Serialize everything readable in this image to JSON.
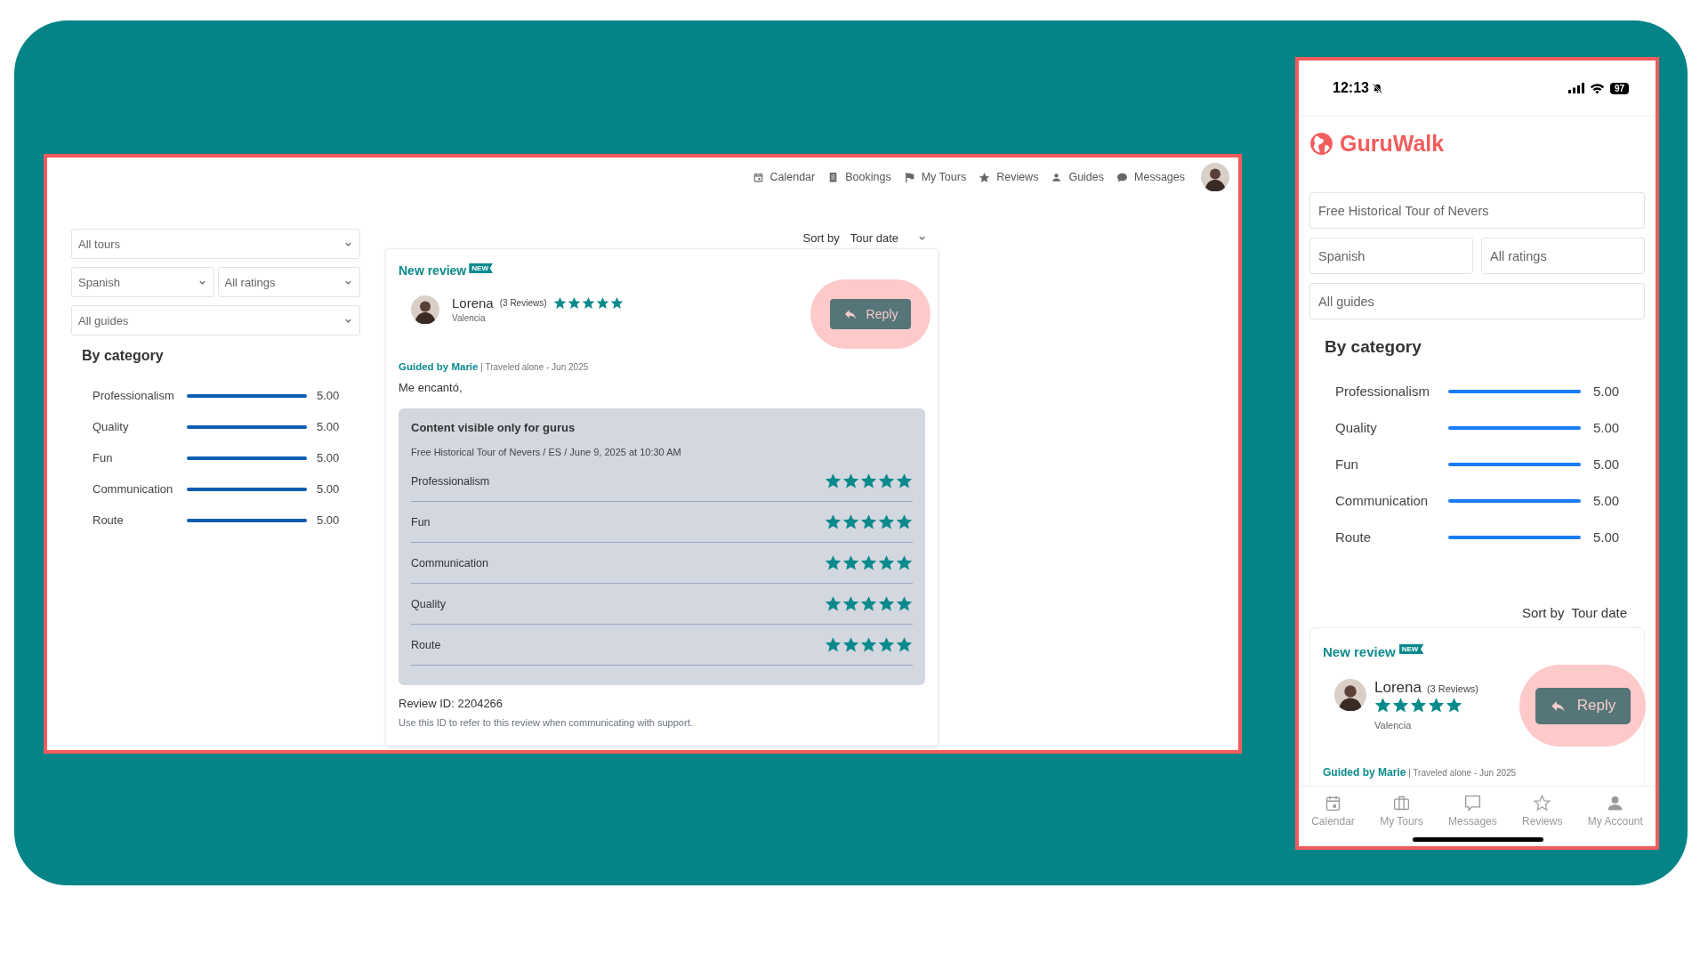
{
  "desktop": {
    "nav": [
      {
        "label": "Calendar"
      },
      {
        "label": "Bookings"
      },
      {
        "label": "My Tours"
      },
      {
        "label": "Reviews"
      },
      {
        "label": "Guides"
      },
      {
        "label": "Messages"
      }
    ],
    "filters": {
      "tour": "All tours",
      "language": "Spanish",
      "rating": "All ratings",
      "guide": "All guides"
    },
    "category_title": "By category",
    "categories": [
      {
        "name": "Professionalism",
        "level": 1,
        "value": "5.00"
      },
      {
        "name": "Quality",
        "level": 1,
        "value": "5.00"
      },
      {
        "name": "Fun",
        "level": 1,
        "value": "5.00"
      },
      {
        "name": "Communication",
        "level": 1,
        "value": "5.00"
      },
      {
        "name": "Route",
        "level": 1,
        "value": "5.00"
      }
    ],
    "sort": {
      "label": "Sort by",
      "value": "Tour date"
    },
    "review": {
      "title": "New review",
      "badge": "NEW",
      "author": "Lorena",
      "author_reviews": "(3 Reviews)",
      "stars": 5,
      "location": "Valencia",
      "reply": "Reply",
      "guided_by": "Guided by Marie",
      "trip": "| Traveled alone - Jun 2025",
      "text": "Me encantó,",
      "private": {
        "title": "Content visible only for gurus",
        "tour": "Free Historical Tour of Nevers / ES / June 9, 2025 at 10:30 AM",
        "ratings": [
          {
            "name": "Professionalism",
            "stars": 5
          },
          {
            "name": "Fun",
            "stars": 5
          },
          {
            "name": "Communication",
            "stars": 5
          },
          {
            "name": "Quality",
            "stars": 5
          },
          {
            "name": "Route",
            "stars": 5
          }
        ]
      },
      "review_id": "Review ID: 2204266",
      "note": "Use this ID to refer to this review when communicating with support."
    }
  },
  "mobile": {
    "status_bar": {
      "time": "12:13",
      "battery": "97"
    },
    "logo": "GuruWalk",
    "filters": {
      "tour": "Free Historical Tour of Nevers",
      "language": "Spanish",
      "rating": "All ratings",
      "guide": "All guides"
    },
    "category_title": "By category",
    "categories": [
      {
        "name": "Professionalism",
        "level": 1,
        "value": "5.00"
      },
      {
        "name": "Quality",
        "level": 1,
        "value": "5.00"
      },
      {
        "name": "Fun",
        "level": 1,
        "value": "5.00"
      },
      {
        "name": "Communication",
        "level": 1,
        "value": "5.00"
      },
      {
        "name": "Route",
        "level": 1,
        "value": "5.00"
      }
    ],
    "sort": {
      "label": "Sort by",
      "value": "Tour date"
    },
    "review": {
      "title": "New review",
      "badge": "NEW",
      "author": "Lorena",
      "author_reviews": "(3 Reviews)",
      "stars": 5,
      "location": "Valencia",
      "reply": "Reply",
      "guided_by": "Guided by Marie",
      "trip": "| Traveled alone - Jun 2025"
    },
    "tab_bar": [
      {
        "label": "Calendar"
      },
      {
        "label": "My Tours"
      },
      {
        "label": "Messages"
      },
      {
        "label": "Reviews"
      },
      {
        "label": "My Account"
      }
    ]
  }
}
